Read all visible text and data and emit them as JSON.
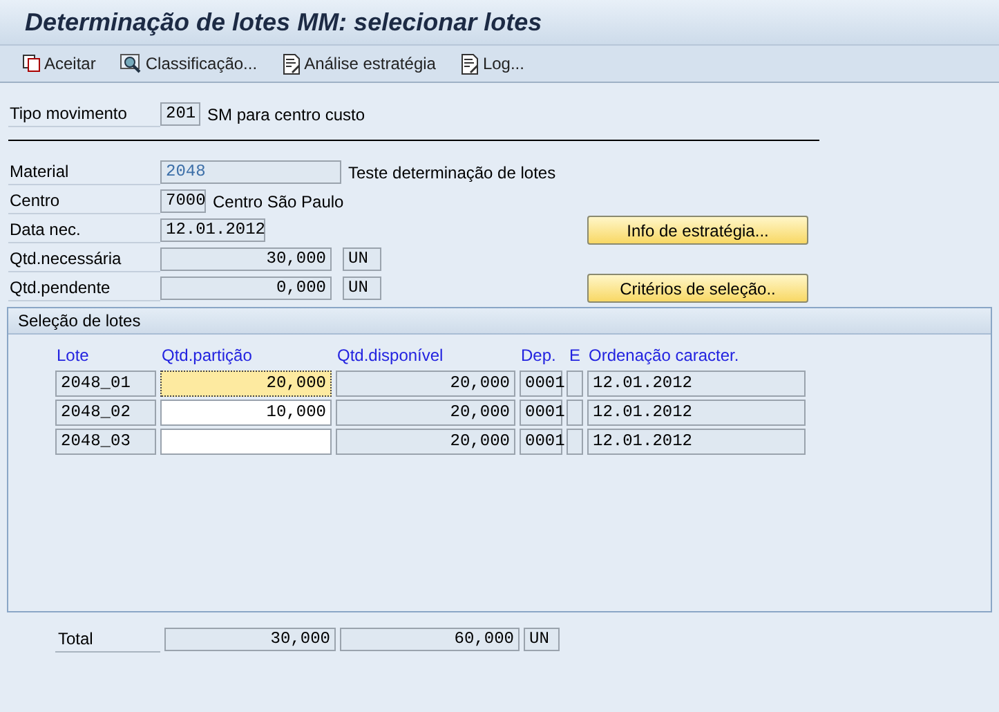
{
  "window": {
    "title": "Determinação de lotes MM: selecionar lotes"
  },
  "toolbar": [
    {
      "label": "Aceitar",
      "kind": "copy"
    },
    {
      "label": "Classificação...",
      "kind": "search"
    },
    {
      "label": "Análise estratégia",
      "kind": "doc"
    },
    {
      "label": "Log...",
      "kind": "doc"
    }
  ],
  "movement": {
    "label": "Tipo movimento",
    "value": "201",
    "description": "SM para centro custo"
  },
  "fields": [
    {
      "label": "Material",
      "value": "2048",
      "kind": "key",
      "description": "Teste determinação de lotes"
    },
    {
      "label": "Centro",
      "value": "7000",
      "kind": "code",
      "description": "Centro São Paulo"
    },
    {
      "label": "Data nec.",
      "value": "12.01.2012",
      "kind": "date",
      "button": "Info de estratégia..."
    },
    {
      "label": "Qtd.necessária",
      "value": "30,000",
      "kind": "number",
      "unit": "UN"
    },
    {
      "label": "Qtd.pendente",
      "value": "0,000",
      "kind": "number",
      "unit": "UN",
      "button": "Critérios de seleção.."
    }
  ],
  "batch_selection": {
    "title": "Seleção de lotes",
    "columns": [
      "Lote",
      "Qtd.partição",
      "Qtd.disponível",
      "Dep.",
      "E",
      "Ordenação caracter."
    ],
    "rows": [
      {
        "lote": "2048_01",
        "partition": "20,000",
        "focused": true,
        "available": "20,000",
        "dep": "0001",
        "ord": "12.01.2012"
      },
      {
        "lote": "2048_02",
        "partition": "10,000",
        "focused": false,
        "available": "20,000",
        "dep": "0001",
        "ord": "12.01.2012"
      },
      {
        "lote": "2048_03",
        "focused": false,
        "available": "20,000",
        "dep": "0001",
        "ord": "12.01.2012"
      }
    ]
  },
  "total": {
    "label": "Total",
    "partition": "30,000",
    "available": "60,000",
    "unit": "UN"
  }
}
